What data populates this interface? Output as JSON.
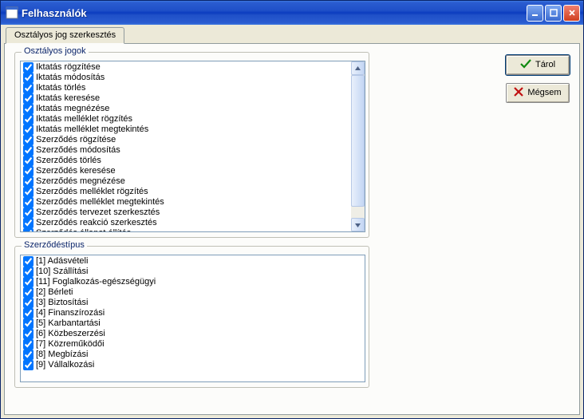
{
  "window": {
    "title": "Felhasználók"
  },
  "tab": {
    "label": "Osztályos jog szerkesztés"
  },
  "groups": {
    "rights": {
      "legend": "Osztályos jogok",
      "items": [
        "Iktatás rögzítése",
        "Iktatás módosítás",
        "Iktatás törlés",
        "Iktatás keresése",
        "Iktatás megnézése",
        "Iktatás melléklet rögzítés",
        "Iktatás melléklet megtekintés",
        "Szerződés rögzítése",
        "Szerződés módosítás",
        "Szerződés törlés",
        "Szerződés keresése",
        "Szerződés megnézése",
        "Szerződés melléklet rögzítés",
        "Szerződés melléklet megtekintés",
        "Szerződés tervezet szerkesztés",
        "Szerződés reakció szerkesztés",
        "Szerződés állapot állítás"
      ]
    },
    "types": {
      "legend": "Szerződéstípus",
      "items": [
        "[1] Adásvételi",
        "[10] Szállítási",
        "[11] Foglalkozás-egészségügyi",
        "[2] Bérleti",
        "[3] Biztosítási",
        "[4] Finanszírozási",
        "[5] Karbantartási",
        "[6] Közbeszerzési",
        "[7] Közreműködői",
        "[8] Megbízási",
        "[9] Vállalkozási"
      ]
    }
  },
  "buttons": {
    "save": "Tárol",
    "cancel": "Mégsem"
  }
}
